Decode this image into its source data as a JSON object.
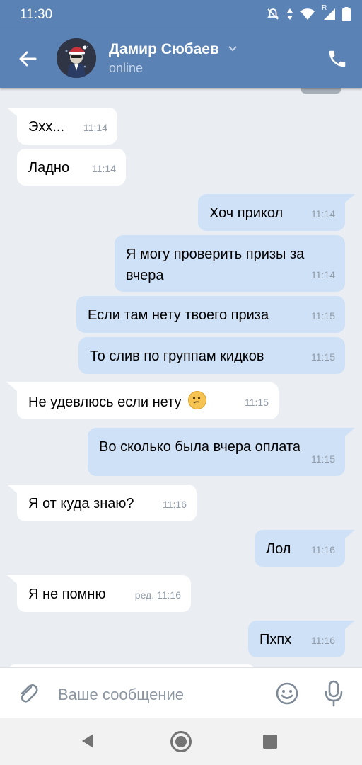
{
  "status_bar": {
    "time": "11:30",
    "icons": [
      "mute-icon",
      "data-arrows-icon",
      "wifi-icon",
      "signal-icon",
      "battery-icon"
    ],
    "roaming_label": "R"
  },
  "header": {
    "contact_name": "Дамир Сюбаев",
    "status": "online",
    "icons": [
      "back-arrow-icon",
      "chevron-down-icon",
      "phone-icon"
    ]
  },
  "messages": [
    {
      "dir": "in",
      "text": "Эхх...",
      "time": "11:14"
    },
    {
      "dir": "in",
      "text": "Ладно",
      "time": "11:14"
    },
    {
      "dir": "out",
      "text": "Хоч прикол",
      "time": "11:14"
    },
    {
      "dir": "out",
      "text": "Я могу проверить призы за",
      "text2": "вчера",
      "time": "11:14"
    },
    {
      "dir": "out",
      "text": "Если там нету твоего приза",
      "time": "11:15"
    },
    {
      "dir": "out",
      "text": "То слив по группам кидков",
      "time": "11:15"
    },
    {
      "dir": "in",
      "text": "Не удевлюсь если нету",
      "emoji": "confused-face-emoji",
      "time": "11:15"
    },
    {
      "dir": "out",
      "text": "Во сколько была вчера оплата",
      "time": "11:15"
    },
    {
      "dir": "in",
      "text": "Я от куда знаю?",
      "time": "11:16"
    },
    {
      "dir": "out",
      "text": "Лол",
      "time": "11:16"
    },
    {
      "dir": "in",
      "text": "Я не помню",
      "time": "ред. 11:16"
    },
    {
      "dir": "out",
      "text": "Пхпх",
      "time": "11:16"
    }
  ],
  "composer": {
    "placeholder": "Ваше сообщение",
    "icons": [
      "paperclip-icon",
      "emoji-icon",
      "microphone-icon"
    ]
  },
  "colors": {
    "header": "#5b82b4",
    "background": "#eaeef3",
    "incoming": "#ffffff",
    "outgoing": "#cfe1f6"
  }
}
